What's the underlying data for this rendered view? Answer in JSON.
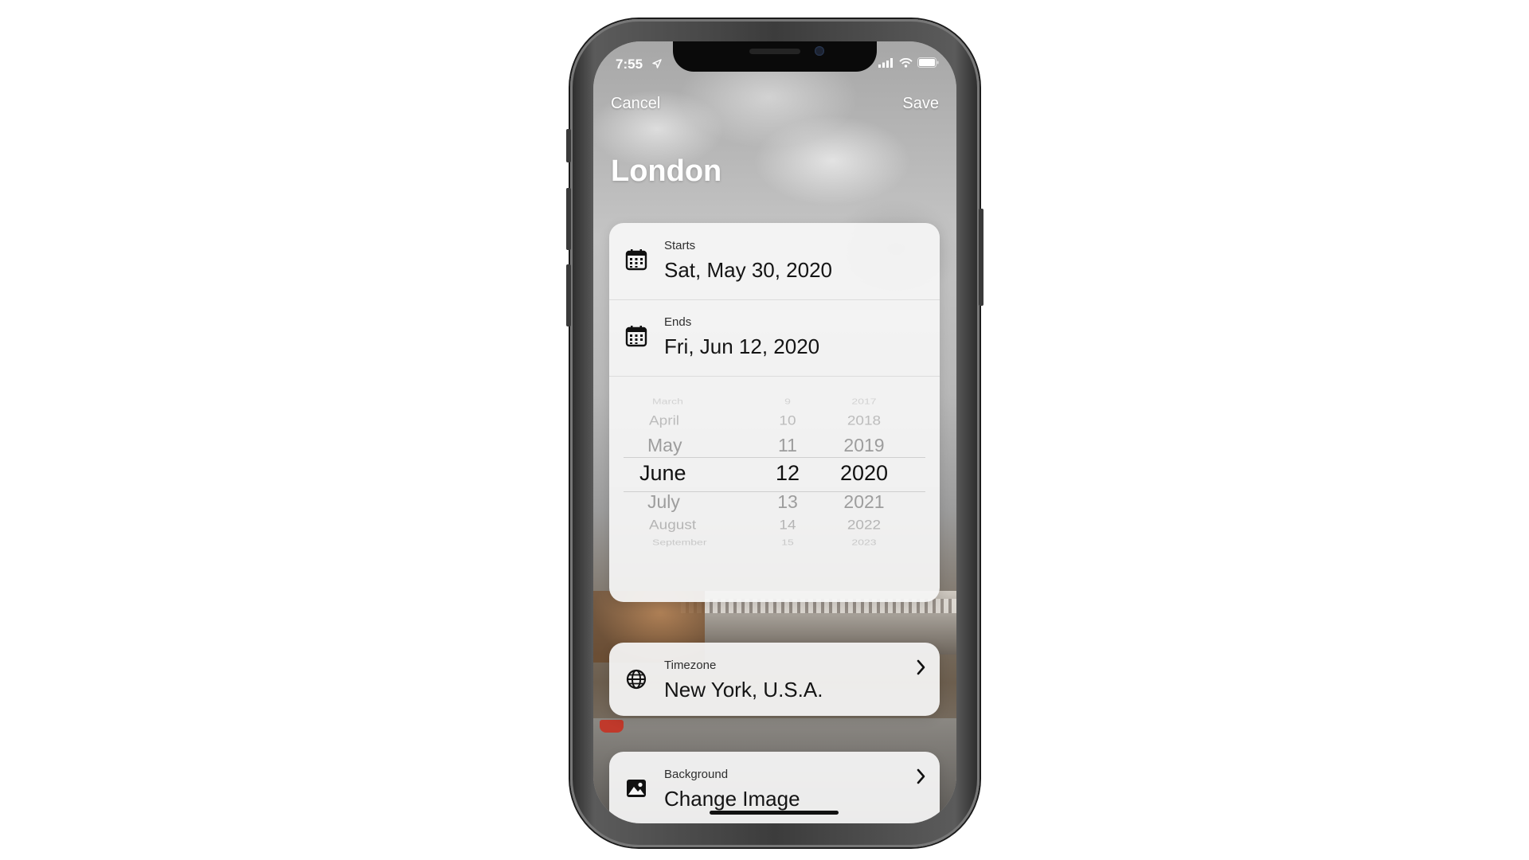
{
  "status_bar": {
    "time": "7:55"
  },
  "nav": {
    "cancel_label": "Cancel",
    "save_label": "Save"
  },
  "city": {
    "title": "London"
  },
  "dates": {
    "starts_label": "Starts",
    "starts_value": "Sat, May 30, 2020",
    "ends_label": "Ends",
    "ends_value": "Fri, Jun 12, 2020"
  },
  "picker": {
    "months": [
      "March",
      "April",
      "May",
      "June",
      "July",
      "August",
      "September"
    ],
    "days": [
      "9",
      "10",
      "11",
      "12",
      "13",
      "14",
      "15"
    ],
    "years": [
      "2017",
      "2018",
      "2019",
      "2020",
      "2021",
      "2022",
      "2023"
    ],
    "selected": {
      "month": "June",
      "day": "12",
      "year": "2020"
    }
  },
  "timezone": {
    "label": "Timezone",
    "value": "New York, U.S.A."
  },
  "background": {
    "label": "Background",
    "value": "Change Image"
  },
  "icons": {
    "starts": "calendar-icon",
    "ends": "calendar-icon",
    "timezone": "globe-icon",
    "background": "image-icon",
    "disclosure": "chevron-right-icon",
    "location": "location-arrow-icon",
    "signal": "cellular-signal-icon",
    "wifi": "wifi-icon",
    "battery": "battery-icon"
  },
  "colors": {
    "text_primary": "#141414",
    "nav_text": "#ffffff",
    "card_bg": "#f6f6f6"
  }
}
